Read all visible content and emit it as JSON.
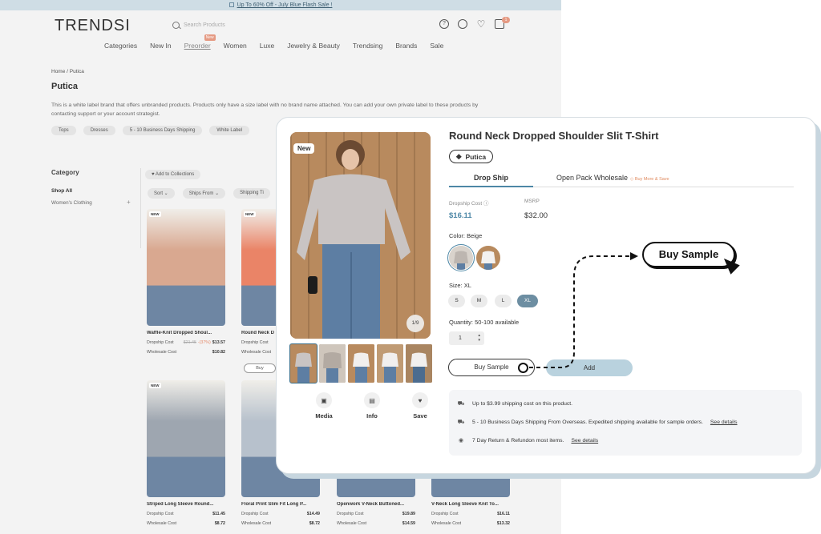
{
  "banner": "Up To 60% Off - July Blue Flash Sale !",
  "header": {
    "logo": "TRENDSI",
    "search_placeholder": "Search Products",
    "cart_count": "1",
    "nav": [
      "Categories",
      "New In",
      "Preorder",
      "Women",
      "Luxe",
      "Jewelry & Beauty",
      "Trendsing",
      "Brands",
      "Sale"
    ],
    "nav_new_tag": "New"
  },
  "breadcrumb": "Home / Putica",
  "brand": {
    "title": "Putica",
    "description": "This is a white label brand that offers unbranded products. Products only have a size label with no brand name attached. You can add your own private label to these products by contacting support or your account strategist.",
    "tags": [
      "Tops",
      "Dresses",
      "5 - 10 Business Days Shipping",
      "White Label"
    ]
  },
  "sidebar": {
    "heading": "Category",
    "shop_all": "Shop All",
    "womens": "Women's Clothing",
    "plus": "+"
  },
  "toolbar": {
    "add_to_collections": "Add to Collections",
    "filters": [
      "Sort",
      "Ships From",
      "Shipping Ti"
    ]
  },
  "grid": {
    "dropship_label": "Dropship Cost",
    "wholesale_label": "Wholesale Cost",
    "new_badge": "NEW",
    "buy_label": "Buy",
    "products": [
      {
        "name": "Waffle-Knit Dropped Shoul...",
        "old": "$21.45",
        "off": "-(37%)",
        "dropship": "$13.57",
        "wholesale": "$10.82",
        "color": "#d9a890"
      },
      {
        "name": "Round Neck D",
        "old": "",
        "off": "",
        "dropship": "",
        "wholesale": "",
        "color": "#ea8467"
      },
      {
        "name": "Striped Long Sleeve Round...",
        "old": "",
        "off": "",
        "dropship": "$11.45",
        "wholesale": "$8.72",
        "color": "#9ea6b0"
      },
      {
        "name": "Floral Print Slim Fit Long P...",
        "old": "",
        "off": "",
        "dropship": "$14.49",
        "wholesale": "$8.72",
        "color": "#b7c1cc"
      },
      {
        "name": "Openwork V-Neck Buttoned...",
        "old": "",
        "off": "",
        "dropship": "$19.89",
        "wholesale": "$14.59",
        "color": "#c9b6a3"
      },
      {
        "name": "V-Neck Long Sleeve Knit To...",
        "old": "",
        "off": "",
        "dropship": "$16.11",
        "wholesale": "$13.32",
        "color": "#b7a999"
      }
    ]
  },
  "modal": {
    "new_badge": "New",
    "pager": "1/9",
    "actions": [
      "Media",
      "Info",
      "Save"
    ],
    "title": "Round Neck Dropped Shoulder Slit T-Shirt",
    "brand": "Putica",
    "tab_dropship": "Drop Ship",
    "tab_wholesale": "Open Pack Wholesale",
    "tab_wholesale_note": "Buy More & Save",
    "dropship_cost_label": "Dropship Cost",
    "dropship_cost": "$16.11",
    "msrp_label": "MSRP",
    "msrp": "$32.00",
    "color_label": "Color: Beige",
    "size_label": "Size: XL",
    "sizes": [
      "S",
      "M",
      "L",
      "XL"
    ],
    "quantity_label": "Quantity: 50-100 available",
    "quantity_value": "1",
    "buy_sample": "Buy Sample",
    "add": "Add",
    "info": [
      {
        "text": "Up to $3.99 shipping cost on this product.",
        "link": ""
      },
      {
        "text": "5 - 10 Business Days Shipping From Overseas. Expedited shipping available for sample orders.",
        "link": "See details"
      },
      {
        "text": "7 Day Return & Refundon most items.",
        "link": "See details"
      }
    ]
  },
  "callout": "Buy Sample",
  "colors": {
    "accent": "#4d87a6",
    "add_button": "#b9d2de",
    "sale": "#e59a83"
  }
}
